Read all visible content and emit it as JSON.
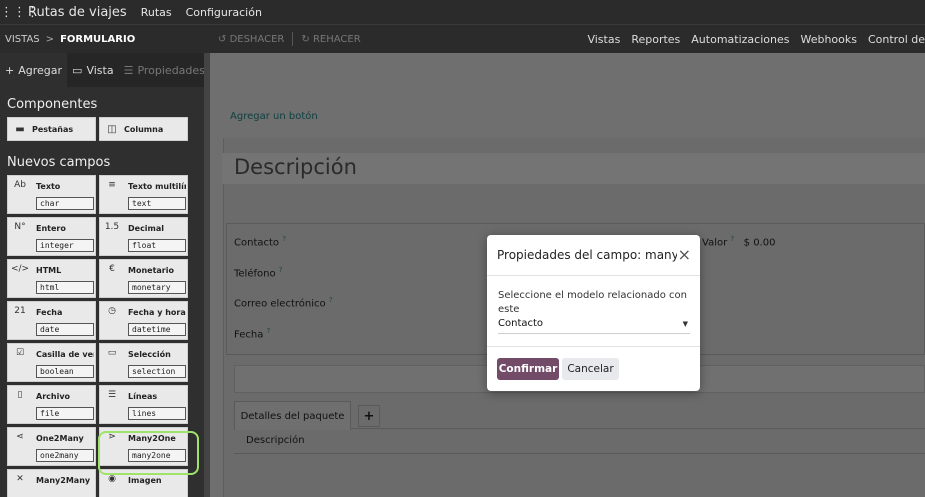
{
  "topnav": {
    "app_title": "Rutas de viajes",
    "menus": [
      "Rutas",
      "Configuración"
    ]
  },
  "controlbar": {
    "breadcrumb": [
      "VISTAS",
      "FORMULARIO"
    ],
    "undo": "DESHACER",
    "redo": "REHACER",
    "right_menu": [
      "Vistas",
      "Reportes",
      "Automatizaciones",
      "Webhooks",
      "Control de"
    ]
  },
  "sidebar": {
    "tabs": [
      {
        "label": "Agregar",
        "icon": "plus-icon"
      },
      {
        "label": "Vista",
        "icon": "monitor-icon"
      },
      {
        "label": "Propiedades",
        "icon": "list-icon"
      }
    ],
    "components_title": "Componentes",
    "components": [
      {
        "label": "Pestañas",
        "icon": "folder-icon"
      },
      {
        "label": "Columna",
        "icon": "columns-icon"
      }
    ],
    "new_fields_title": "Nuevos campos",
    "fields": [
      {
        "label": "Texto",
        "type": "char",
        "icon": "Ab"
      },
      {
        "label": "Texto multilín...",
        "type": "text",
        "icon": "≡"
      },
      {
        "label": "Entero",
        "type": "integer",
        "icon": "N°"
      },
      {
        "label": "Decimal",
        "type": "float",
        "icon": "1.5"
      },
      {
        "label": "HTML",
        "type": "html",
        "icon": "</>"
      },
      {
        "label": "Monetario",
        "type": "monetary",
        "icon": "€"
      },
      {
        "label": "Fecha",
        "type": "date",
        "icon": "21"
      },
      {
        "label": "Fecha y hora",
        "type": "datetime",
        "icon": "◷"
      },
      {
        "label": "Casilla de ver...",
        "type": "boolean",
        "icon": "☑"
      },
      {
        "label": "Selección",
        "type": "selection",
        "icon": "▭"
      },
      {
        "label": "Archivo",
        "type": "file",
        "icon": "▯"
      },
      {
        "label": "Líneas",
        "type": "lines",
        "icon": "☰"
      },
      {
        "label": "One2Many",
        "type": "one2many",
        "icon": "⋖"
      },
      {
        "label": "Many2One",
        "type": "many2one",
        "icon": "⋗"
      },
      {
        "label": "Many2Many",
        "type": "",
        "icon": "✕"
      },
      {
        "label": "Imagen",
        "type": "",
        "icon": "◉"
      }
    ]
  },
  "form": {
    "add_button": "Agregar un botón",
    "title": "Descripción",
    "fields_left": [
      {
        "label": "Contacto",
        "help": "?"
      },
      {
        "label": "Teléfono",
        "help": "?"
      },
      {
        "label": "Correo electrónico",
        "help": "?"
      },
      {
        "label": "Fecha",
        "help": "?"
      }
    ],
    "field_right": {
      "label": "Valor",
      "help": "?",
      "value": "$ 0.00"
    },
    "tab": "Detalles del paquete",
    "tab_add": "+",
    "column_header": "Descripción"
  },
  "modal": {
    "title": "Propiedades del campo: many...",
    "close": "×",
    "label": "Seleccione el modelo relacionado con este",
    "select_value": "Contacto",
    "confirm": "Confirmar",
    "cancel": "Cancelar"
  }
}
